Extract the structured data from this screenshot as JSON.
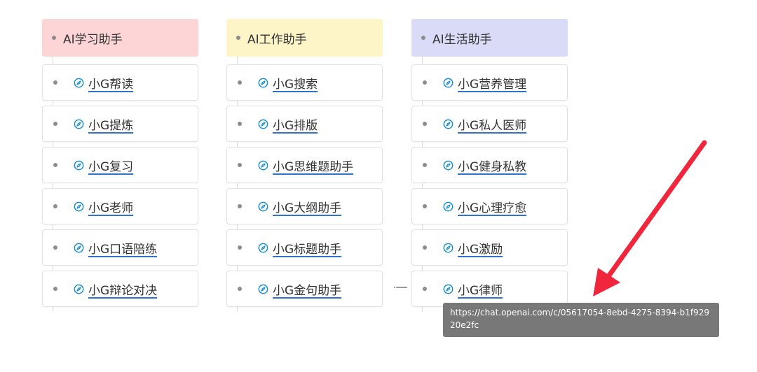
{
  "columns": [
    {
      "title": "AI学习助手",
      "color": "#fdd5d6",
      "items": [
        "小G帮读",
        "小G提炼",
        "小G复习",
        "小G老师",
        "小G口语陪练",
        "小G辩论对决"
      ]
    },
    {
      "title": "AI工作助手",
      "color": "#fdf4c7",
      "items": [
        "小G搜索",
        "小G排版",
        "小G思维题助手",
        "小G大纲助手",
        "小G标题助手",
        "小G金句助手"
      ]
    },
    {
      "title": "AI生活助手",
      "color": "#dadcf7",
      "items": [
        "小G营养管理",
        "小G私人医师",
        "小G健身私教",
        "小G心理疗愈",
        "小G激励",
        "小G律师"
      ]
    }
  ],
  "tooltip": {
    "url": "https://chat.openai.com/c/05617054-8ebd-4275-8394-b1f92920e2fc"
  },
  "icons": {
    "link": "compass-icon"
  },
  "colors": {
    "link_icon": "#1a8fd4",
    "arrow": "#f0263c",
    "underline": "#2e75c9"
  }
}
